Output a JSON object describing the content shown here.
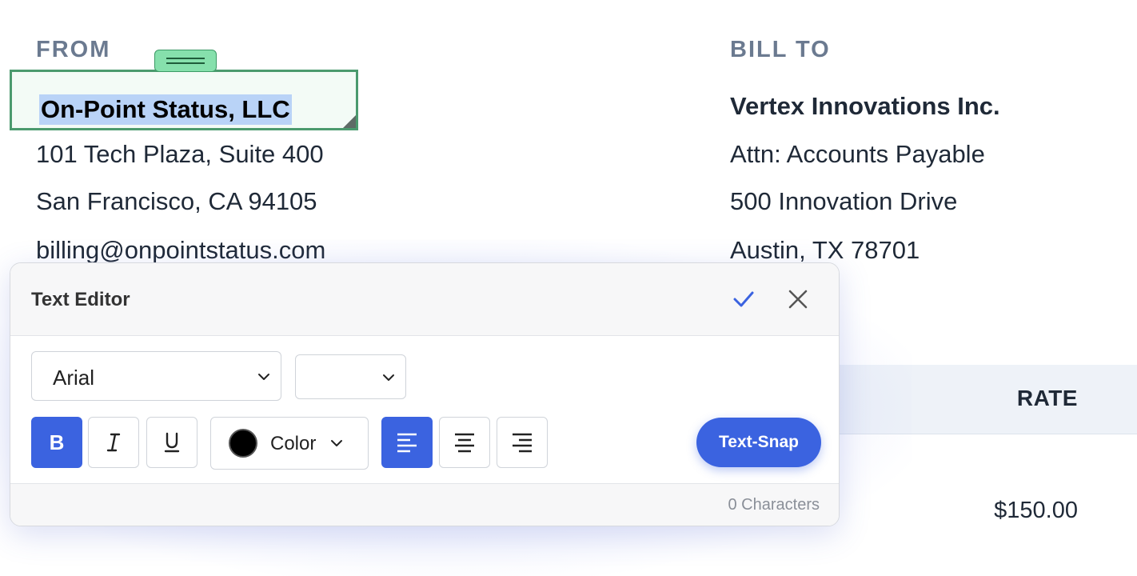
{
  "from": {
    "label": "FROM",
    "company": "On-Point Status, LLC",
    "address_line1": "101 Tech Plaza, Suite 400",
    "address_line2": "San Francisco, CA 94105",
    "email": "billing@onpointstatus.com"
  },
  "bill_to": {
    "label": "BILL TO",
    "company": "Vertex Innovations Inc.",
    "attn": "Attn: Accounts Payable",
    "address_line1": "500 Innovation Drive",
    "address_line2": "Austin, TX 78701"
  },
  "table": {
    "rate_header": "RATE",
    "first_rate": "$150.00"
  },
  "editor": {
    "title": "Text Editor",
    "font_family": "Arial",
    "font_size": "",
    "bold_label": "B",
    "italic_label": "I",
    "underline_label": "U",
    "color_label": "Color",
    "text_color": "#000000",
    "snap_label": "Text-Snap",
    "char_count": "0 Characters",
    "bold_active": true,
    "alignment": "left"
  },
  "colors": {
    "accent": "#3b63e0",
    "selection_border": "#4b9a6e",
    "text_highlight": "#b9d3f7"
  },
  "icons": {
    "confirm": "check-icon",
    "close": "close-icon",
    "dropdown": "chevron-down-icon",
    "drag": "drag-handle-icon",
    "align_left": "align-left-icon",
    "align_center": "align-center-icon",
    "align_right": "align-right-icon"
  }
}
